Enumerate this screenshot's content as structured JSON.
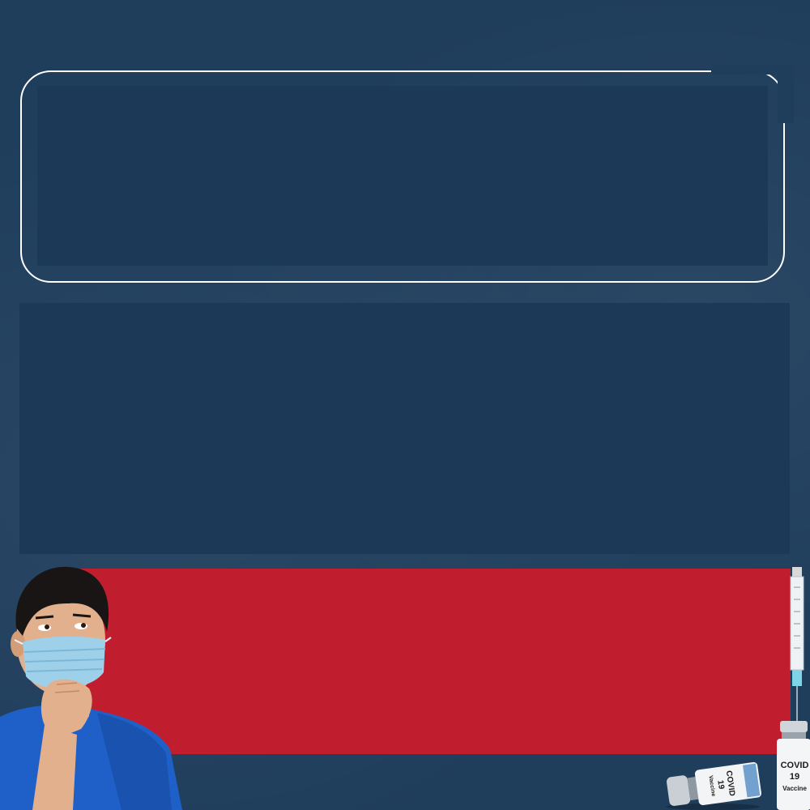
{
  "vials": {
    "upright": {
      "line1": "COVID",
      "line2": "19",
      "line3": "Vaccine"
    },
    "lying": {
      "line1": "COVID",
      "line2": "19",
      "line3": "Vaccine"
    }
  },
  "colors": {
    "background": "#1f3e5c",
    "panel": "#1c3a57",
    "accent_red": "#c01e2f",
    "outline": "#ffffff"
  },
  "icons": [
    "person-thinking-illustration",
    "syringe-icon",
    "vaccine-vial-icon"
  ]
}
